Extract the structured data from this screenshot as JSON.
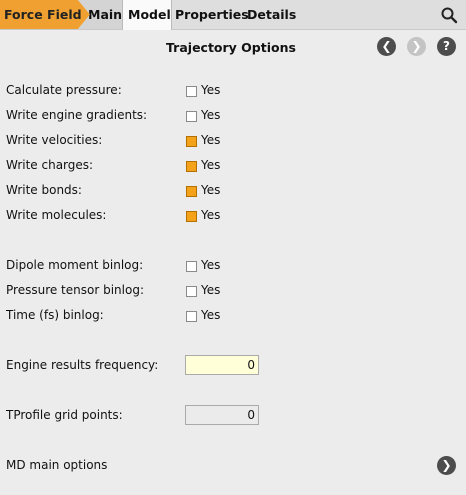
{
  "tabs": {
    "force_field": "Force Field",
    "main": "Main",
    "model": "Model",
    "properties": "Properties",
    "details": "Details"
  },
  "header": {
    "title": "Trajectory Options",
    "back_glyph": "❮",
    "forward_glyph": "❯",
    "help_glyph": "?"
  },
  "options": {
    "calc_pressure": {
      "label": "Calculate pressure:",
      "value": "Yes",
      "checked": false
    },
    "engine_gradients": {
      "label": "Write engine gradients:",
      "value": "Yes",
      "checked": false
    },
    "velocities": {
      "label": "Write velocities:",
      "value": "Yes",
      "checked": true
    },
    "charges": {
      "label": "Write charges:",
      "value": "Yes",
      "checked": true
    },
    "bonds": {
      "label": "Write bonds:",
      "value": "Yes",
      "checked": true
    },
    "molecules": {
      "label": "Write molecules:",
      "value": "Yes",
      "checked": true
    },
    "dipole_binlog": {
      "label": "Dipole moment binlog:",
      "value": "Yes",
      "checked": false
    },
    "pressure_binlog": {
      "label": "Pressure tensor binlog:",
      "value": "Yes",
      "checked": false
    },
    "time_binlog": {
      "label": "Time (fs) binlog:",
      "value": "Yes",
      "checked": false
    }
  },
  "fields": {
    "engine_results_frequency": {
      "label": "Engine results frequency:",
      "value": "0"
    },
    "tprofile_grid_points": {
      "label": "TProfile grid points:",
      "value": "0"
    }
  },
  "footer": {
    "md_main_options": "MD main options",
    "go_glyph": "❯"
  },
  "colors": {
    "accent": "#f0a030",
    "checked": "#f5a21b",
    "field_yellow": "#ffffd8"
  }
}
